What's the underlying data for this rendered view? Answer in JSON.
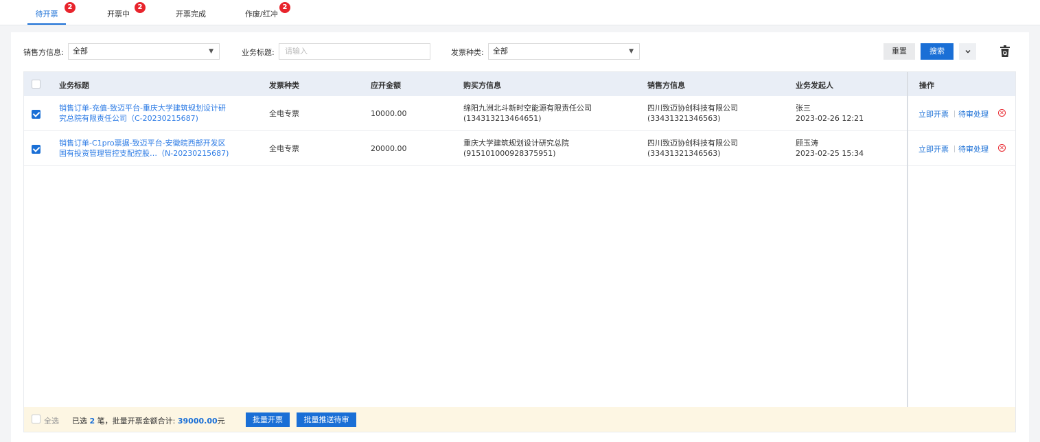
{
  "tabs": [
    {
      "label": "待开票",
      "badge": "2"
    },
    {
      "label": "开票中",
      "badge": "2"
    },
    {
      "label": "开票完成",
      "badge": ""
    },
    {
      "label": "作废/红冲",
      "badge": "2"
    }
  ],
  "filters": {
    "seller_label": "销售方信息:",
    "seller_value": "全部",
    "title_label": "业务标题:",
    "title_placeholder": "请输入",
    "type_label": "发票种类:",
    "type_value": "全部",
    "reset_label": "重置",
    "search_label": "搜索"
  },
  "table": {
    "headers": [
      "业务标题",
      "发票种类",
      "应开金额",
      "购买方信息",
      "销售方信息",
      "业务发起人",
      "操作"
    ],
    "rows": [
      {
        "title_line1": "销售订单-充值-致迈平台-重庆大学建筑规划设计研",
        "title_line2": "究总院有限责任公司（C-20230215687)",
        "type": "全电专票",
        "amount": "10000.00",
        "buyer_name": "绵阳九洲北斗新时空能源有限责任公司",
        "buyer_id": "(134313213464651)",
        "seller_name": "四川致迈协创科技有限公司",
        "seller_id": "(33431321346563)",
        "initiator": "张三",
        "time": "2023-02-26 12:21",
        "op_invoice": "立即开票",
        "op_review": "待审处理",
        "checked": true
      },
      {
        "title_line1": "销售订单-C1pro票据-致迈平台-安徽皖西部开发区",
        "title_line2": "国有投资管理管控支配控股…（N-20230215687)",
        "type": "全电专票",
        "amount": "20000.00",
        "buyer_name": "重庆大学建筑规划设计研究总院",
        "buyer_id": "(915101000928375951)",
        "seller_name": "四川致迈协创科技有限公司",
        "seller_id": "(33431321346563)",
        "initiator": "顾玉涛",
        "time": "2023-02-25 15:34",
        "op_invoice": "立即开票",
        "op_review": "待审处理",
        "checked": true
      }
    ]
  },
  "footer": {
    "select_all": "全选",
    "selected_prefix": "已选",
    "selected_count": "2",
    "selected_suffix": "笔，批量开票金额合计:",
    "total": "39000.00",
    "unit": "元",
    "batch_invoice": "批量开票",
    "batch_push": "批量推送待审"
  },
  "icons": {
    "caret": "triangle-down",
    "chevron": "chevron-down",
    "recycle": "recycle-bin",
    "remove": "circle-x"
  },
  "colors": {
    "accent": "#1a6fd6",
    "badge": "#e8242c",
    "footer_bg": "#fdf6e3"
  }
}
